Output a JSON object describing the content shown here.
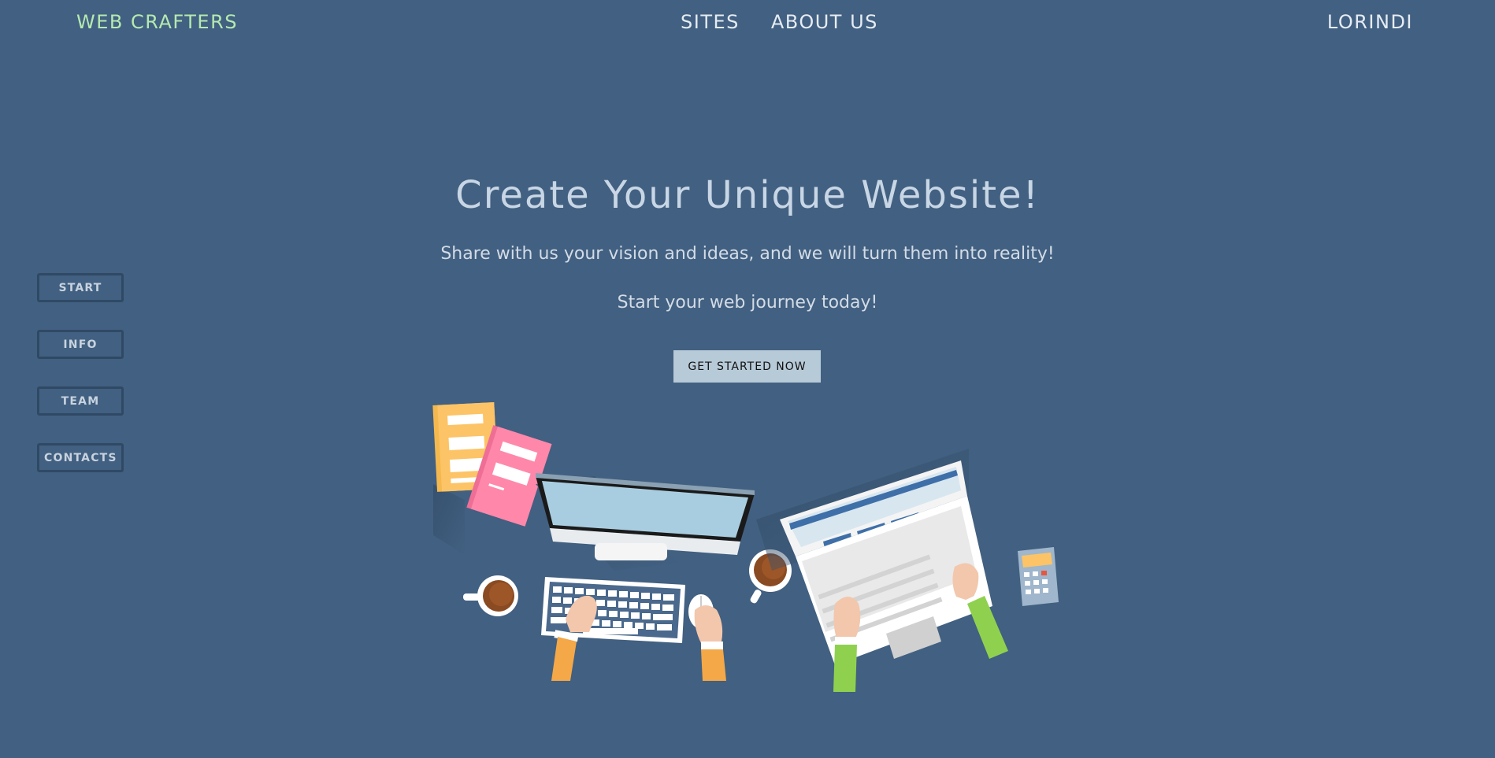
{
  "header": {
    "brand": "WEB CRAFTERS",
    "nav": [
      "SITES",
      "ABOUT US"
    ],
    "user": "LORINDI"
  },
  "sidenav": {
    "items": [
      "START",
      "INFO",
      "TEAM",
      "CONTACTS"
    ]
  },
  "hero": {
    "title": "Create Your Unique Website!",
    "subtitle": "Share with us your vision and ideas, and we will turn them into reality!",
    "tagline": "Start your web journey today!",
    "cta_label": "GET STARTED NOW"
  },
  "colors": {
    "background": "#426081",
    "brand": "#b5eab0",
    "cta_bg": "#b7cad8"
  }
}
